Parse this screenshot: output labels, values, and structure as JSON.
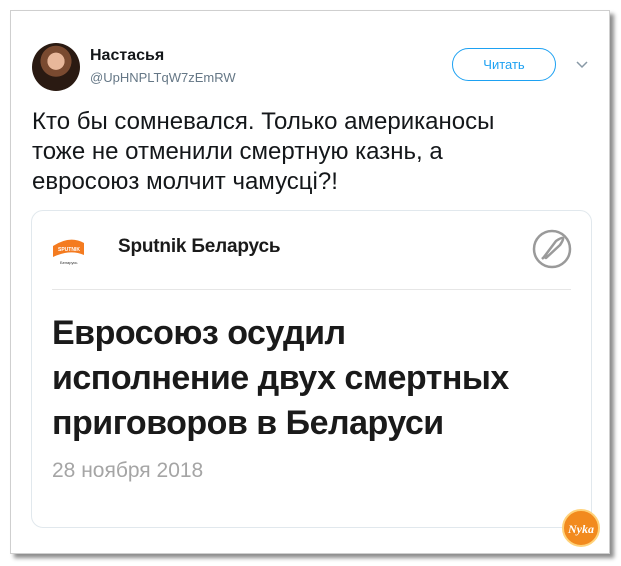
{
  "user": {
    "name": "Настасья",
    "handle": "@UpHNPLTqW7zEmRW"
  },
  "actions": {
    "follow_label": "Читать",
    "caret_icon": "chevron-down-icon"
  },
  "tweet": {
    "lines": [
      "Кто бы сомневался. Только американосы",
      "тоже не отменили смертную казнь, а",
      "евросоюз молчит чамусці?!"
    ]
  },
  "card": {
    "source": "Sputnik Беларусь",
    "logo_text": "SPUTNIK",
    "logo_subtext": "Беларусь",
    "emblem_icon": "rocket-icon",
    "headline_lines": [
      "Евросоюз осудил",
      "исполнение двух смертных",
      "приговоров в Беларуси"
    ],
    "date": "28 ноября 2018"
  },
  "watermark": {
    "text": "Nyka"
  },
  "colors": {
    "accent": "#1da1f2",
    "logo_orange": "#f47b20",
    "watermark_orange": "#f28a1e"
  }
}
